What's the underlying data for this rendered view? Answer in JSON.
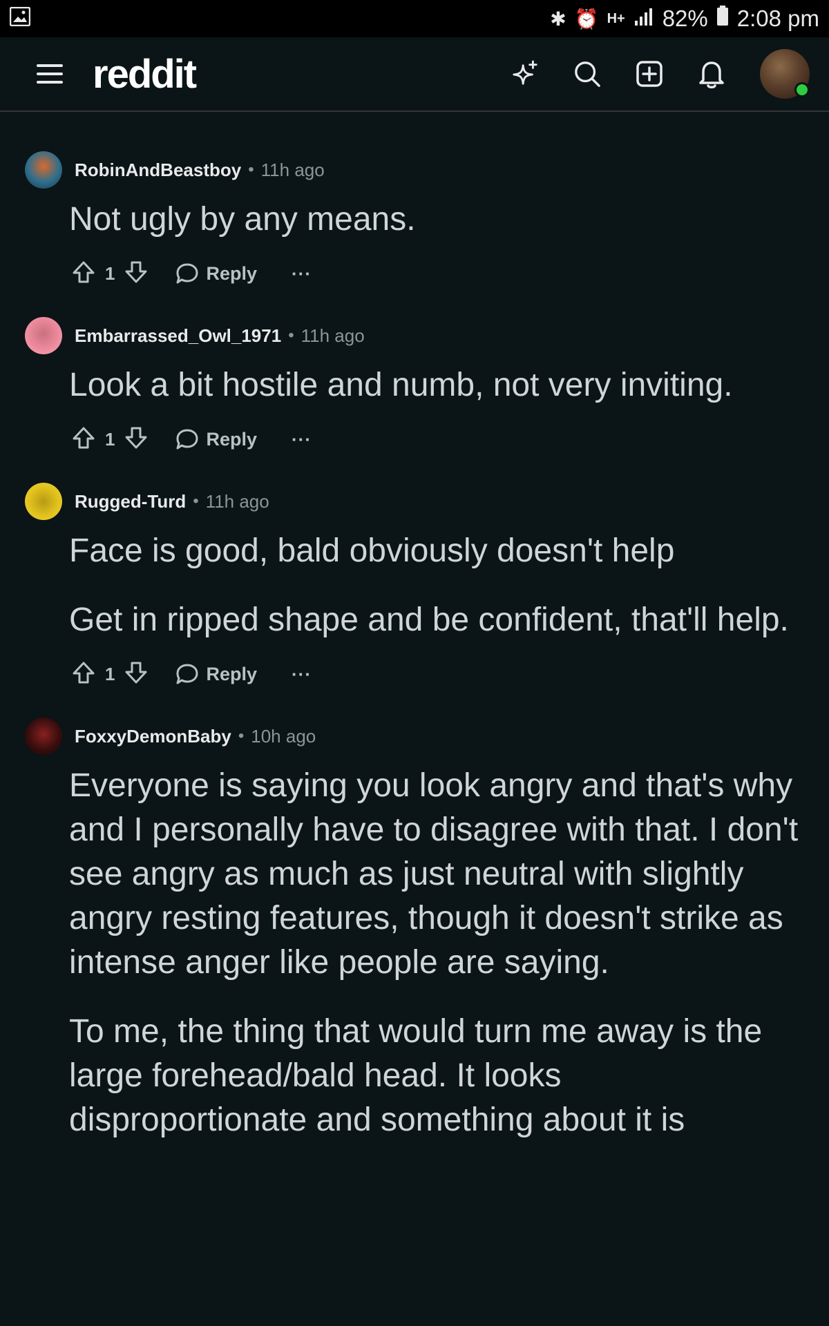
{
  "status_bar": {
    "battery": "82%",
    "time": "2:08 pm",
    "icons": [
      "gallery-icon",
      "bluetooth-icon",
      "alarm-icon",
      "hplus-icon",
      "signal-icon",
      "battery-icon"
    ]
  },
  "header": {
    "wordmark": "reddit",
    "icons": [
      "menu-icon",
      "sparkle-icon",
      "search-icon",
      "create-post-icon",
      "notification-bell-icon",
      "user-avatar"
    ]
  },
  "colors": {
    "background": "#0b1416",
    "text": "#cfd5d8",
    "meta": "#8b9597",
    "divider": "#343536",
    "online": "#2ecc40"
  },
  "comments": [
    {
      "author": "RobinAndBeastboy",
      "time": "11h ago",
      "paragraphs": [
        "Not ugly by any means."
      ],
      "votes": "1",
      "reply_label": "Reply"
    },
    {
      "author": "Embarrassed_Owl_1971",
      "time": "11h ago",
      "paragraphs": [
        "Look a bit hostile and numb, not very inviting."
      ],
      "votes": "1",
      "reply_label": "Reply"
    },
    {
      "author": "Rugged-Turd",
      "time": "11h ago",
      "paragraphs": [
        "Face is good, bald obviously doesn't help",
        "Get in ripped shape and be confident, that'll help."
      ],
      "votes": "1",
      "reply_label": "Reply"
    },
    {
      "author": "FoxxyDemonBaby",
      "time": "10h ago",
      "paragraphs": [
        "Everyone is saying you look angry and that's why and I personally have to disagree with that. I don't see angry as much as just neutral with slightly angry resting features, though it doesn't strike as intense anger like people are saying.",
        "To me, the thing that would turn me away is the large forehead/bald head. It looks disproportionate and something about it is"
      ]
    }
  ],
  "more_label": "···"
}
